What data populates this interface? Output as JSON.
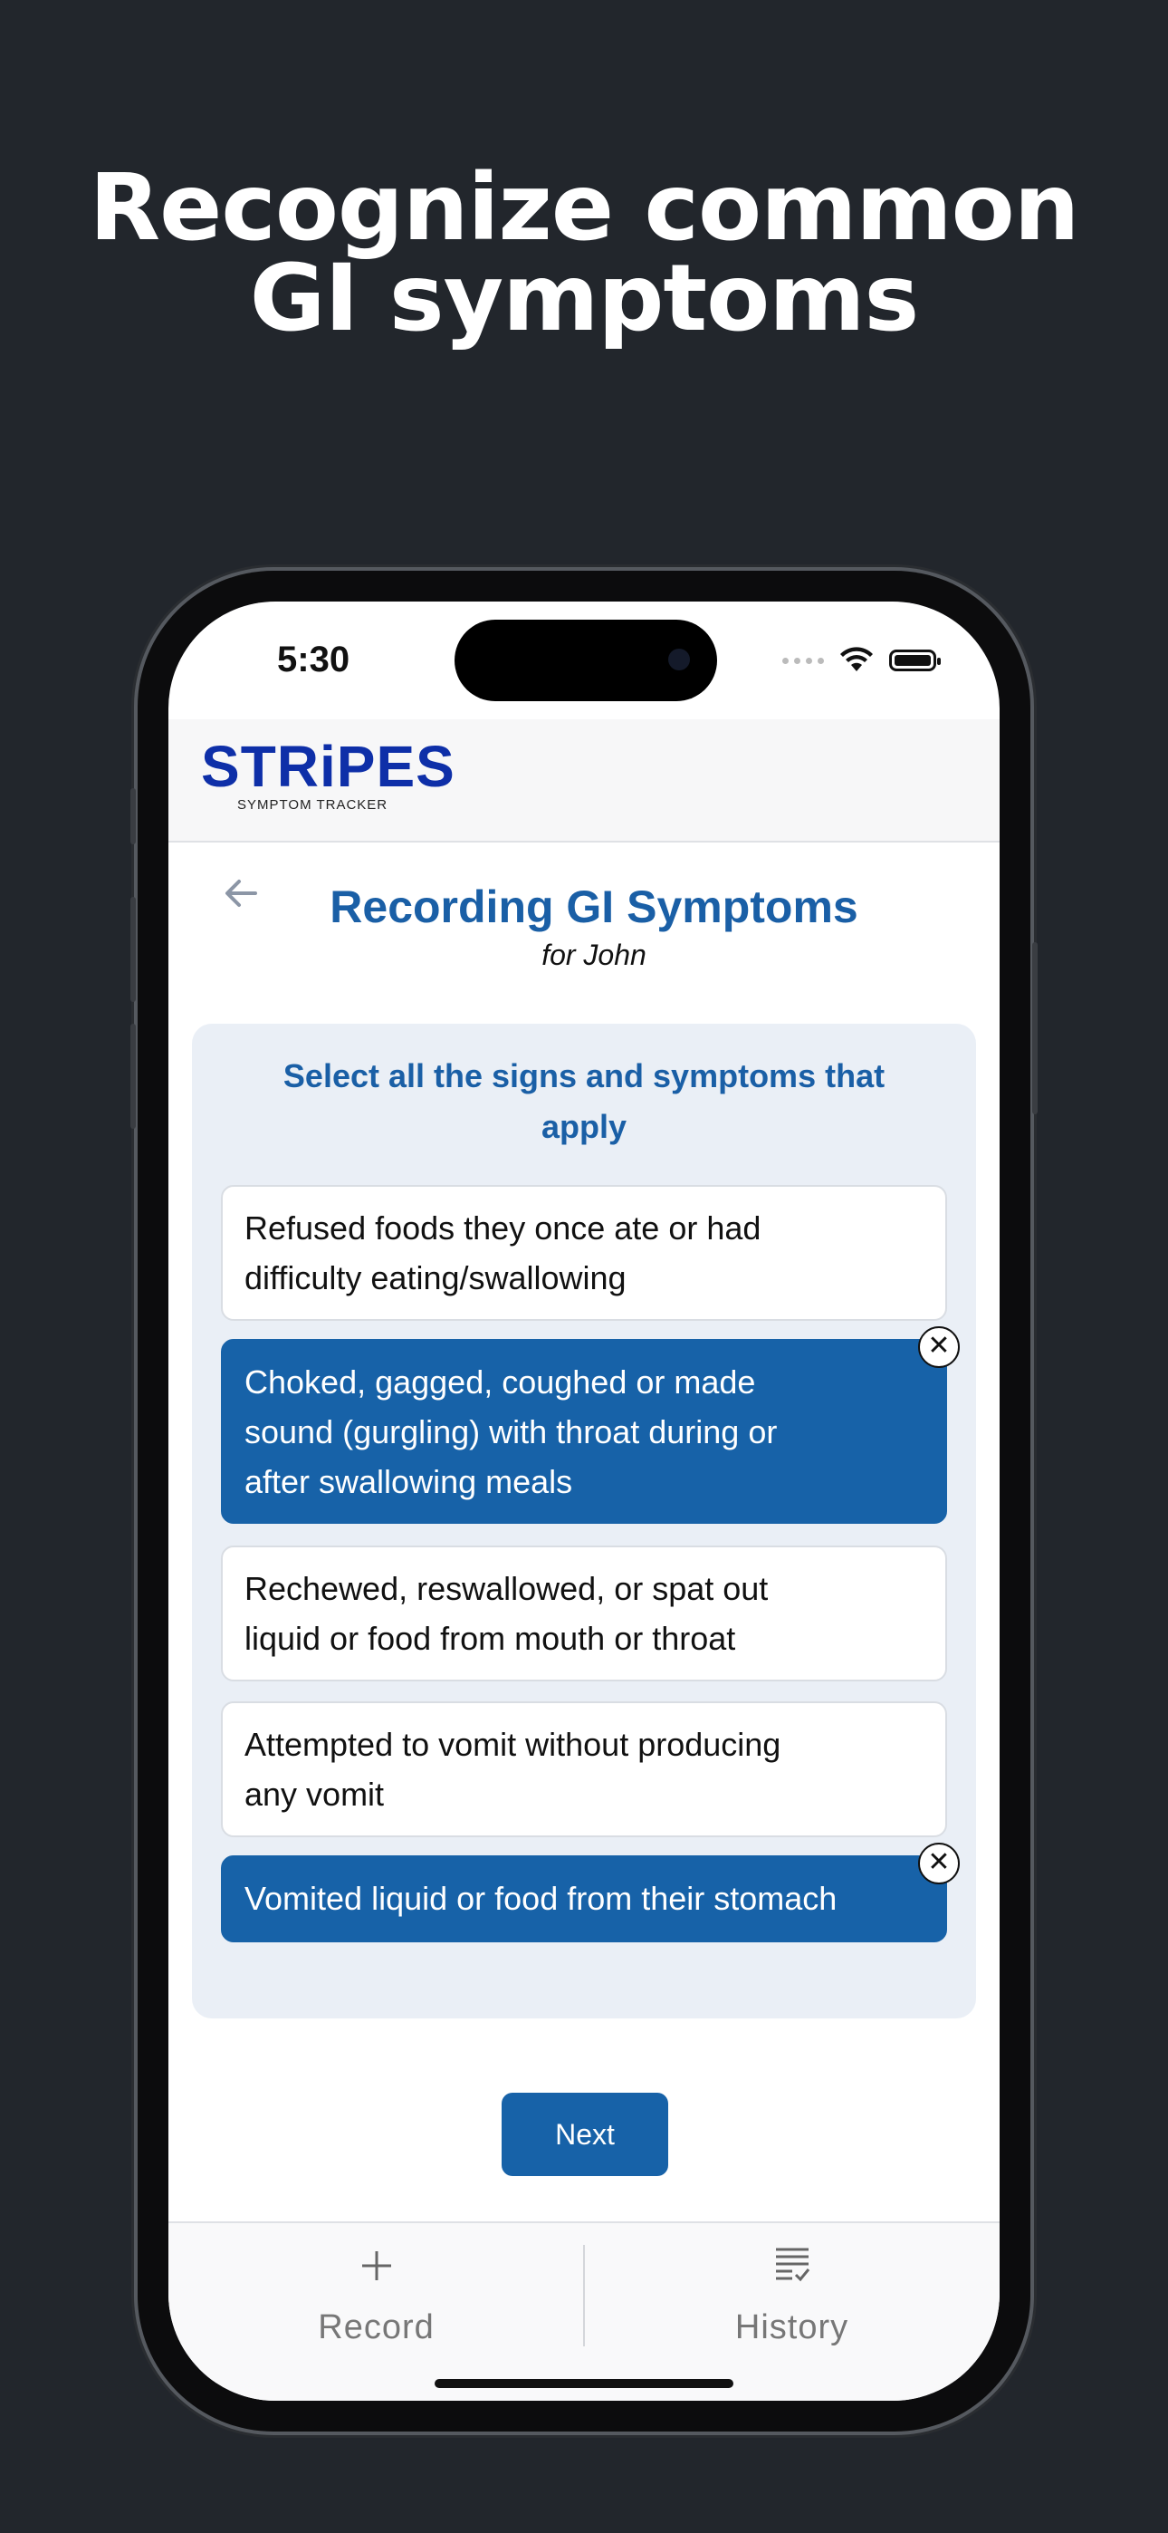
{
  "headline": {
    "line1": "Recognize common",
    "line2": "GI symptoms"
  },
  "status": {
    "time": "5:30"
  },
  "app": {
    "logo_main": "STRiPES",
    "logo_sub": "SYMPTOM TRACKER"
  },
  "page": {
    "title": "Recording GI Symptoms",
    "subtitle": "for John"
  },
  "prompt": {
    "line1": "Select all the signs and symptoms that",
    "line2": "apply"
  },
  "options": [
    {
      "lines": [
        "Refused foods they once ate or had",
        "difficulty eating/swallowing"
      ],
      "selected": false
    },
    {
      "lines": [
        "Choked, gagged, coughed or made",
        "sound (gurgling) with throat during or",
        "after swallowing meals"
      ],
      "selected": true
    },
    {
      "lines": [
        "Rechewed, reswallowed, or spat out",
        "liquid or food from mouth or throat"
      ],
      "selected": false
    },
    {
      "lines": [
        "Attempted to vomit without producing",
        "any vomit"
      ],
      "selected": false
    },
    {
      "lines": [
        "Vomited liquid or food from their stomach"
      ],
      "selected": true
    }
  ],
  "next_label": "Next",
  "tabs": {
    "record": "Record",
    "history": "History"
  },
  "icons": {
    "back": "arrow-left-icon",
    "remove": "close-icon",
    "record": "plus-icon",
    "history": "list-check-icon"
  },
  "colors": {
    "background": "#22262c",
    "accent": "#1762a8",
    "panel": "#eaeff6",
    "logo": "#0e2fa8"
  }
}
